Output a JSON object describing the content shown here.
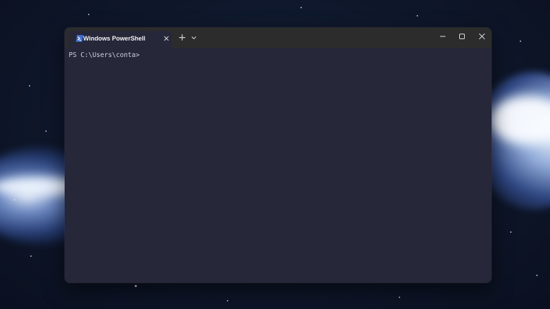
{
  "window": {
    "tab_title": "Windows PowerShell",
    "tab_icon": "powershell-icon",
    "tab_close_icon": "close-icon",
    "new_tab_label": "+",
    "dropdown_icon": "chevron-down-icon",
    "controls": [
      "minimize-icon",
      "maximize-icon",
      "close-icon"
    ]
  },
  "terminal": {
    "prompt": "PS C:\\Users\\conta>"
  },
  "colors": {
    "terminal_bg": "#262739",
    "titlebar_bg": "#2c2c2c",
    "text": "#d0d3e0"
  }
}
